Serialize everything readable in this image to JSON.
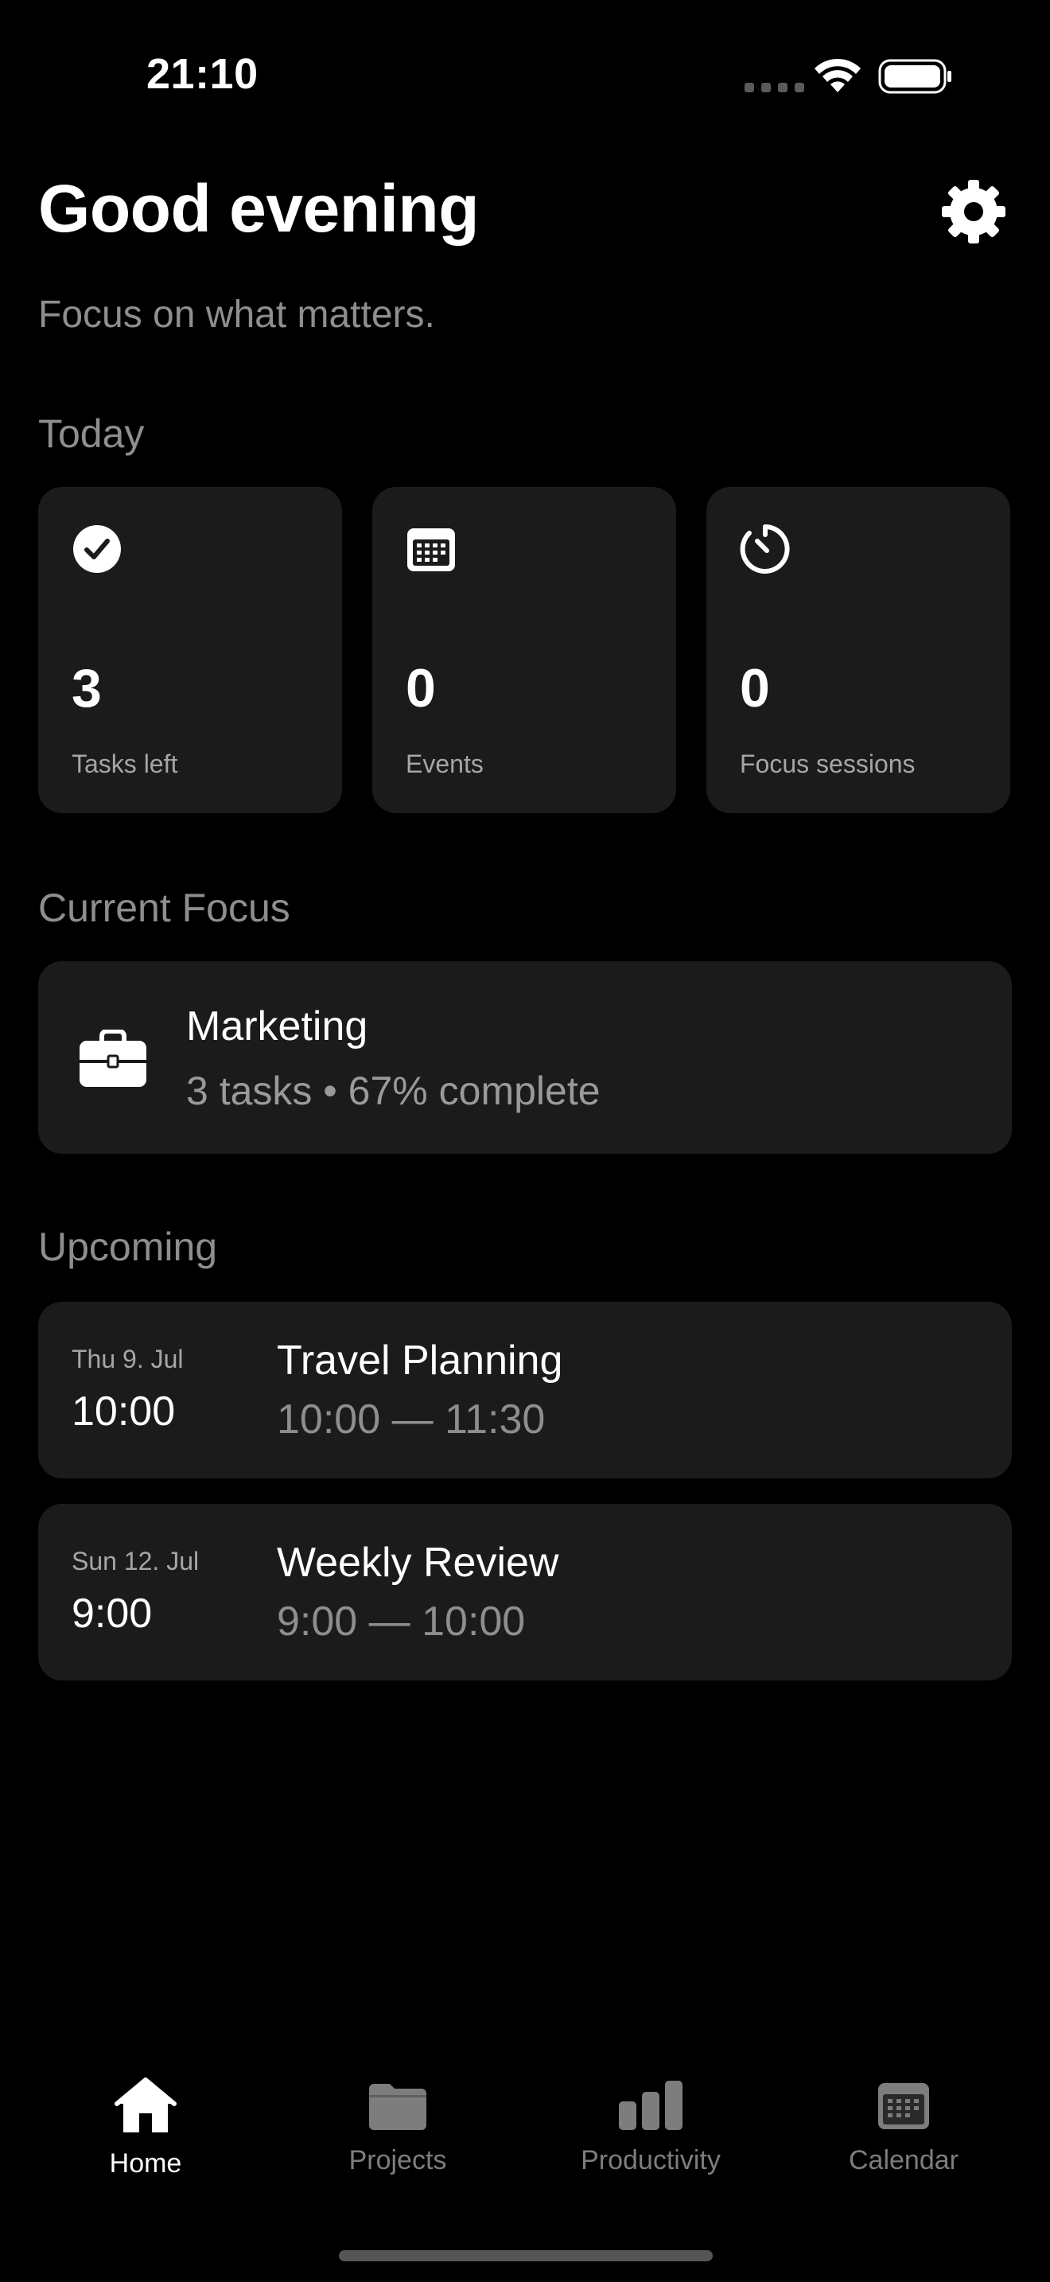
{
  "status_bar": {
    "time": "21:10",
    "icons": [
      "signal-dots-icon",
      "wifi-icon",
      "battery-icon"
    ]
  },
  "header": {
    "greeting": "Good evening",
    "subtitle": "Focus on what matters.",
    "settings_icon": "gear-icon"
  },
  "today": {
    "title": "Today",
    "stats": [
      {
        "icon": "checkmark-circle-icon",
        "value": "3",
        "label": "Tasks left"
      },
      {
        "icon": "calendar-icon",
        "value": "0",
        "label": "Events"
      },
      {
        "icon": "timer-icon",
        "value": "0",
        "label": "Focus sessions"
      }
    ]
  },
  "current_focus": {
    "title": "Current Focus",
    "icon": "briefcase-icon",
    "name": "Marketing",
    "meta": "3 tasks • 67% complete"
  },
  "upcoming": {
    "title": "Upcoming",
    "events": [
      {
        "date": "Thu 9. Jul",
        "time": "10:00",
        "title": "Travel Planning",
        "range": "10:00 — 11:30"
      },
      {
        "date": "Sun 12. Jul",
        "time": "9:00",
        "title": "Weekly Review",
        "range": "9:00 — 10:00"
      }
    ]
  },
  "tab_bar": {
    "tabs": [
      {
        "label": "Home",
        "icon": "home-icon",
        "active": true
      },
      {
        "label": "Projects",
        "icon": "folder-icon",
        "active": false
      },
      {
        "label": "Productivity",
        "icon": "bar-chart-icon",
        "active": false
      },
      {
        "label": "Calendar",
        "icon": "calendar-icon",
        "active": false
      }
    ]
  },
  "colors": {
    "background": "#000000",
    "card": "#1b1b1b",
    "muted_text": "#8e8e8e",
    "inactive_tab": "#7d7d7d"
  }
}
